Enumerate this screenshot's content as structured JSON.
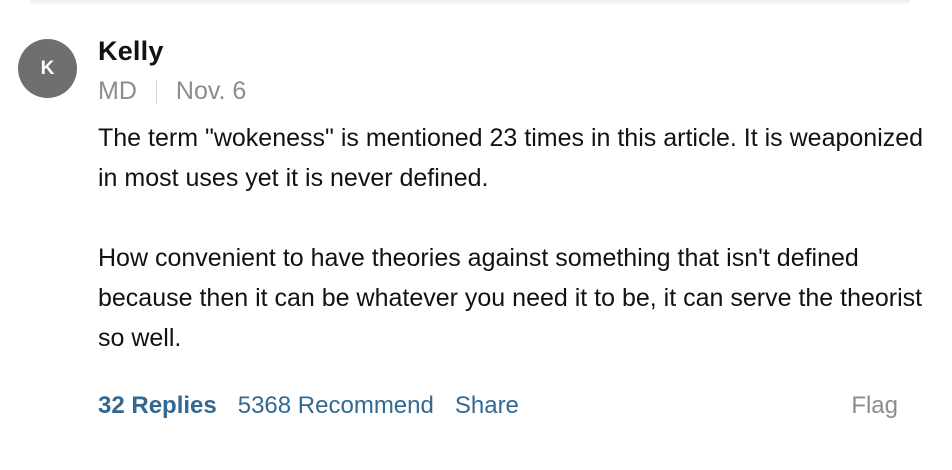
{
  "comment": {
    "avatar_initial": "K",
    "author": "Kelly",
    "location": "MD",
    "date": "Nov. 6",
    "paragraphs": [
      "The term \"wokeness\" is mentioned 23 times in this article. It is weaponized in most uses yet it is never defined.",
      "How convenient to have theories against something that isn't defined because then it can be whatever you need it to be, it can serve the theorist so well."
    ],
    "actions": {
      "replies": "32 Replies",
      "recommend": "5368 Recommend",
      "share": "Share",
      "flag": "Flag"
    }
  },
  "colors": {
    "avatar_bg": "#6f6f6f",
    "link_blue": "#326891",
    "meta_gray": "#8c8c8c",
    "text": "#121212"
  }
}
